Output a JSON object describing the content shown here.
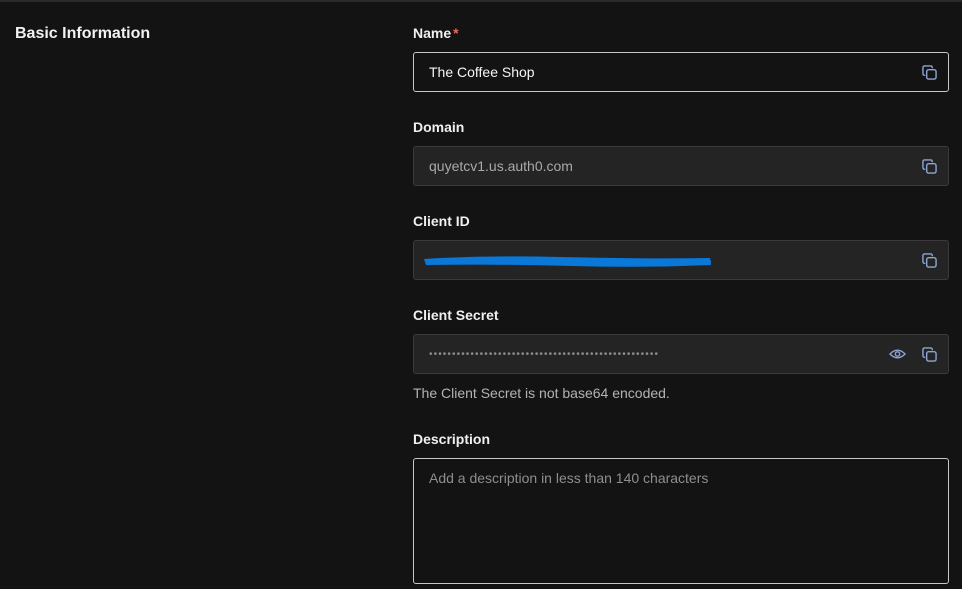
{
  "section": {
    "title": "Basic Information"
  },
  "fields": {
    "name": {
      "label": "Name",
      "required_mark": "*",
      "value": "The Coffee Shop"
    },
    "domain": {
      "label": "Domain",
      "value": "quyetcv1.us.auth0.com"
    },
    "client_id": {
      "label": "Client ID",
      "value_redacted": true
    },
    "client_secret": {
      "label": "Client Secret",
      "masked_value": "••••••••••••••••••••••••••••••••••••••••••••••••••",
      "helper": "The Client Secret is not base64 encoded."
    },
    "description": {
      "label": "Description",
      "placeholder": "Add a description in less than 140 characters"
    }
  },
  "icons": {
    "copy": "copy-icon",
    "eye": "eye-icon"
  },
  "colors": {
    "background": "#131313",
    "required": "#f2665a",
    "redaction": "#0a78d8",
    "icon": "#8fa4d6"
  }
}
